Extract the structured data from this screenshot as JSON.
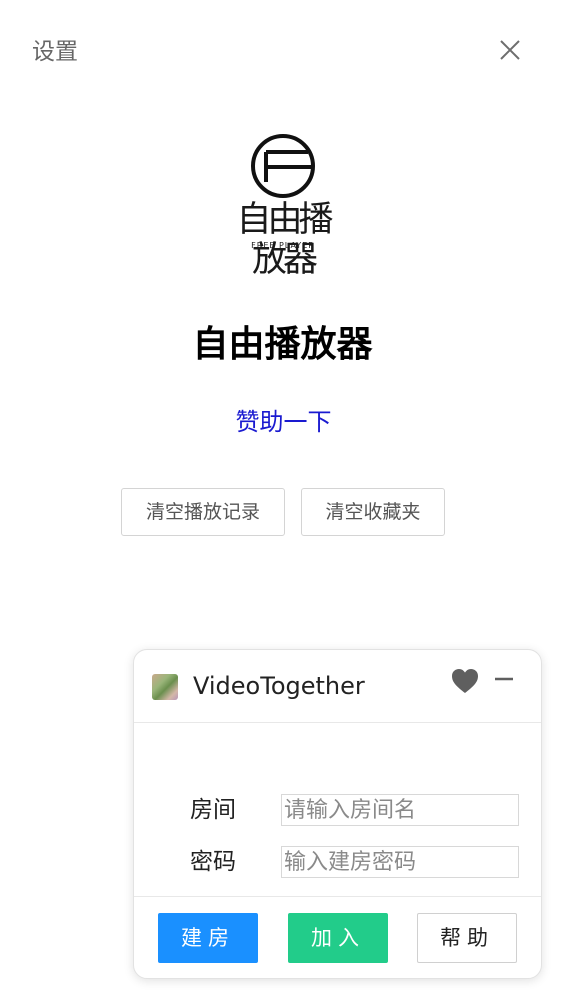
{
  "header": {
    "title": "设置",
    "close_icon": "close-icon"
  },
  "logo": {
    "text": "自由播放器",
    "subtitle": "FREE PLAYER"
  },
  "app": {
    "title": "自由播放器",
    "donate_label": "赞助一下",
    "clear_history_label": "清空播放记录",
    "clear_favorites_label": "清空收藏夹"
  },
  "colors": {
    "link": "#1a1ad0",
    "create_button": "#1a90ff",
    "join_button": "#22cc8a"
  },
  "video_together": {
    "title": "VideoTogether",
    "icons": [
      "heart-icon",
      "minimize-icon"
    ],
    "room_label": "房间",
    "room_placeholder": "请输入房间名",
    "password_label": "密码",
    "password_placeholder": "输入建房密码",
    "create_label": "建房",
    "join_label": "加入",
    "help_label": "帮助"
  }
}
